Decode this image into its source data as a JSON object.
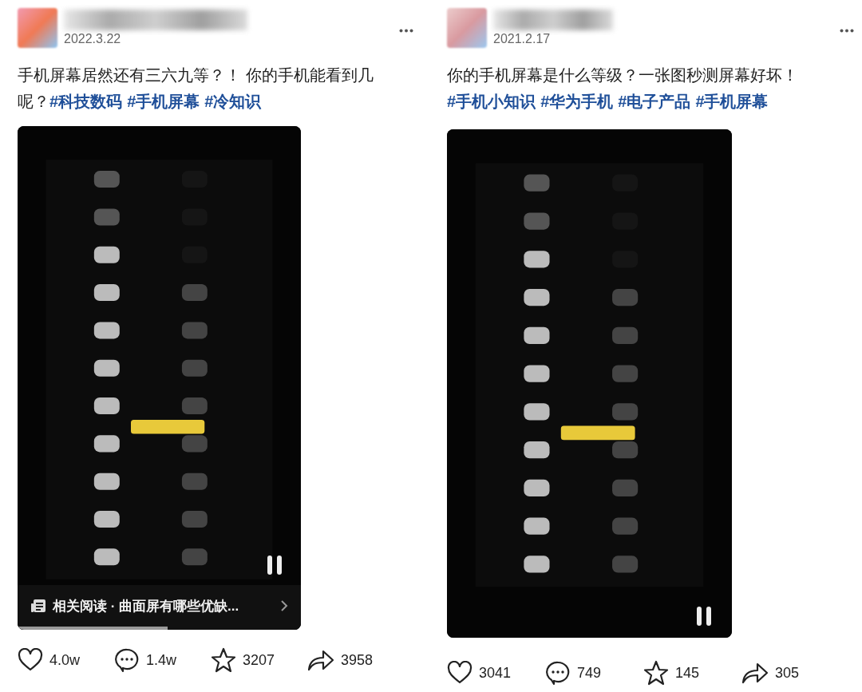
{
  "posts": [
    {
      "date": "2022.3.22",
      "text": "手机屏幕居然还有三六九等？！ 你的手机能看到几呢？",
      "tags": [
        "#科技数码",
        "#手机屏幕",
        "#冷知识"
      ],
      "video": {
        "kind": "picture",
        "related": "相关阅读 · 曲面屏有哪些优缺...",
        "level": 0.53
      },
      "actions": [
        {
          "kind": "like",
          "count": "4.0w"
        },
        {
          "kind": "comment",
          "count": "1.4w"
        },
        {
          "kind": "favorite",
          "count": "3207"
        },
        {
          "kind": "share",
          "count": "3958"
        }
      ]
    },
    {
      "date": "2021.2.17",
      "text": "你的手机屏幕是什么等级？一张图秒测屏幕好坏！",
      "tags": [
        "#手机小知识",
        "#华为手机",
        "#电子产品",
        "#手机屏幕"
      ],
      "actions": [
        {
          "kind": "like",
          "count": "3041"
        },
        {
          "kind": "comment",
          "count": "749"
        },
        {
          "kind": "favorite",
          "count": "145"
        },
        {
          "kind": "share",
          "count": "305"
        }
      ]
    }
  ]
}
